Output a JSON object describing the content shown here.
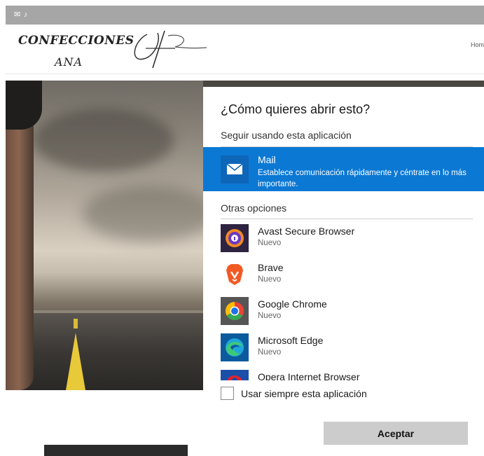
{
  "site": {
    "logo_line1": "CONFECCIONES",
    "logo_line2": "ANA",
    "nav_home": "Hom"
  },
  "dialog": {
    "title": "¿Cómo quieres abrir esto?",
    "keep_label": "Seguir usando esta aplicación",
    "current_app": {
      "name": "Mail",
      "description": "Establece comunicación rápidamente y céntrate en lo más importante.",
      "icon": "mail-envelope-icon",
      "highlight_color": "#0b78d4"
    },
    "other_label": "Otras opciones",
    "apps": [
      {
        "name": "Avast Secure Browser",
        "sub": "Nuevo",
        "icon": "avast-browser-icon"
      },
      {
        "name": "Brave",
        "sub": "Nuevo",
        "icon": "brave-lion-icon"
      },
      {
        "name": "Google Chrome",
        "sub": "Nuevo",
        "icon": "chrome-icon"
      },
      {
        "name": "Microsoft Edge",
        "sub": "Nuevo",
        "icon": "edge-icon"
      },
      {
        "name": "Opera Internet Browser",
        "sub": "",
        "icon": "opera-icon"
      }
    ],
    "always_use_label": "Usar siempre esta aplicación",
    "always_use_checked": false,
    "accept_label": "Aceptar"
  }
}
